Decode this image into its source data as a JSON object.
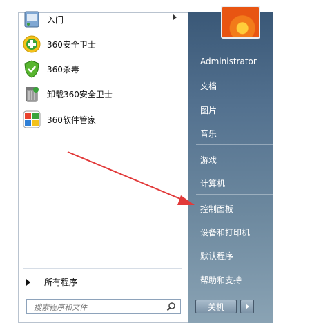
{
  "left_panel": {
    "programs": [
      {
        "label": "入门",
        "icon": "getting-started-icon",
        "has_submenu": true
      },
      {
        "label": "360安全卫士",
        "icon": "360-safe-icon",
        "has_submenu": false
      },
      {
        "label": "360杀毒",
        "icon": "360-antivirus-icon",
        "has_submenu": false
      },
      {
        "label": "卸载360安全卫士",
        "icon": "uninstall-icon",
        "has_submenu": false
      },
      {
        "label": "360软件管家",
        "icon": "360-software-manager-icon",
        "has_submenu": false
      }
    ],
    "all_programs": "所有程序",
    "search_placeholder": "搜索程序和文件"
  },
  "right_panel": {
    "items": [
      {
        "label": "Administrator"
      },
      {
        "label": "文档"
      },
      {
        "label": "图片"
      },
      {
        "label": "音乐"
      },
      {
        "label": "游戏"
      },
      {
        "label": "计算机"
      },
      {
        "label": "控制面板"
      },
      {
        "label": "设备和打印机"
      },
      {
        "label": "默认程序"
      },
      {
        "label": "帮助和支持"
      }
    ],
    "shutdown_label": "关机"
  },
  "colors": {
    "right_panel_top": "#3a5877",
    "right_panel_bottom": "#8aa3b4",
    "annotation_arrow": "#e23a3a"
  }
}
